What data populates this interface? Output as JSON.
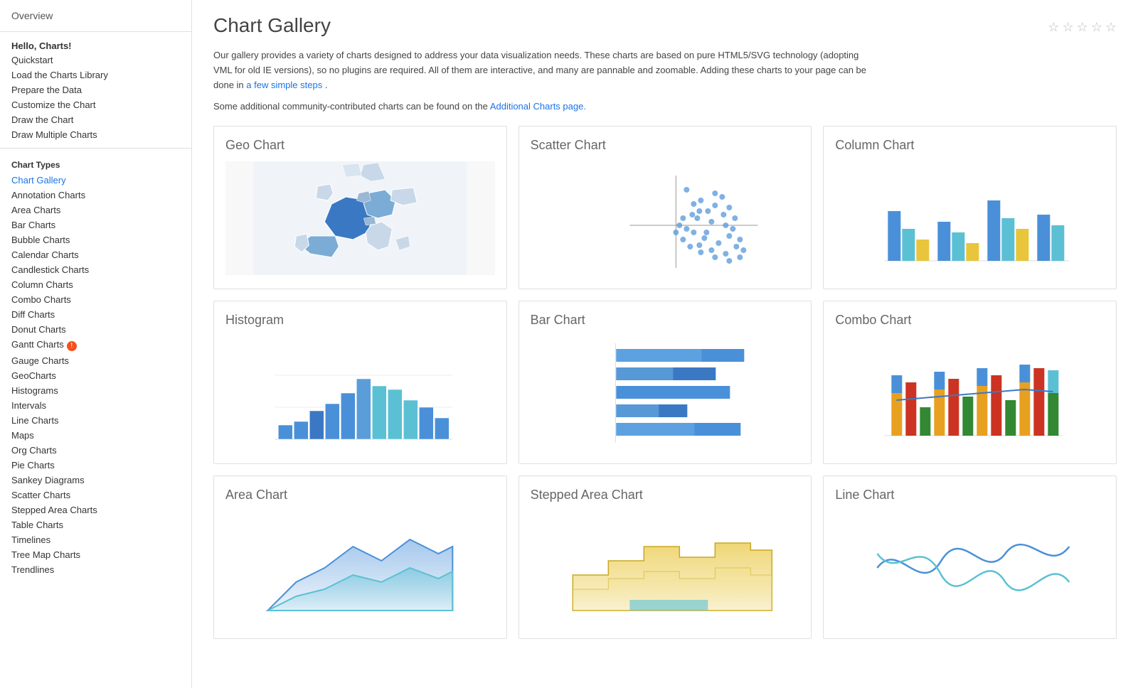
{
  "sidebar": {
    "overview_label": "Overview",
    "hello_label": "Hello, Charts!",
    "links": [
      {
        "label": "Quickstart",
        "active": false
      },
      {
        "label": "Load the Charts Library",
        "active": false
      },
      {
        "label": "Prepare the Data",
        "active": false
      },
      {
        "label": "Customize the Chart",
        "active": false
      },
      {
        "label": "Draw the Chart",
        "active": false
      },
      {
        "label": "Draw Multiple Charts",
        "active": false
      }
    ],
    "chart_types_title": "Chart Types",
    "chart_types": [
      {
        "label": "Chart Gallery",
        "active": true
      },
      {
        "label": "Annotation Charts",
        "active": false
      },
      {
        "label": "Area Charts",
        "active": false
      },
      {
        "label": "Bar Charts",
        "active": false
      },
      {
        "label": "Bubble Charts",
        "active": false
      },
      {
        "label": "Calendar Charts",
        "active": false
      },
      {
        "label": "Candlestick Charts",
        "active": false
      },
      {
        "label": "Column Charts",
        "active": false
      },
      {
        "label": "Combo Charts",
        "active": false
      },
      {
        "label": "Diff Charts",
        "active": false
      },
      {
        "label": "Donut Charts",
        "active": false
      },
      {
        "label": "Gantt Charts",
        "active": false,
        "badge": true
      },
      {
        "label": "Gauge Charts",
        "active": false
      },
      {
        "label": "GeoCharts",
        "active": false
      },
      {
        "label": "Histograms",
        "active": false
      },
      {
        "label": "Intervals",
        "active": false
      },
      {
        "label": "Line Charts",
        "active": false
      },
      {
        "label": "Maps",
        "active": false
      },
      {
        "label": "Org Charts",
        "active": false
      },
      {
        "label": "Pie Charts",
        "active": false
      },
      {
        "label": "Sankey Diagrams",
        "active": false
      },
      {
        "label": "Scatter Charts",
        "active": false
      },
      {
        "label": "Stepped Area Charts",
        "active": false
      },
      {
        "label": "Table Charts",
        "active": false
      },
      {
        "label": "Timelines",
        "active": false
      },
      {
        "label": "Tree Map Charts",
        "active": false
      },
      {
        "label": "Trendlines",
        "active": false
      }
    ]
  },
  "main": {
    "title": "Chart Gallery",
    "stars": [
      "☆",
      "☆",
      "☆",
      "☆",
      "☆"
    ],
    "description1": "Our gallery provides a variety of charts designed to address your data visualization needs. These charts are based on pure HTML5/SVG technology (adopting VML for old IE versions), so no plugins are required. All of them are interactive, and many are pannable and zoomable. Adding these charts to your page can be done in",
    "description_link1": "a few simple steps",
    "description1_end": ".",
    "description2": "Some additional community-contributed charts can be found on the",
    "description_link2": "Additional Charts page.",
    "charts": [
      {
        "title": "Geo Chart",
        "type": "geo"
      },
      {
        "title": "Scatter Chart",
        "type": "scatter"
      },
      {
        "title": "Column Chart",
        "type": "column"
      },
      {
        "title": "Histogram",
        "type": "histogram"
      },
      {
        "title": "Bar Chart",
        "type": "bar"
      },
      {
        "title": "Combo Chart",
        "type": "combo"
      },
      {
        "title": "Area Chart",
        "type": "area"
      },
      {
        "title": "Stepped Area Chart",
        "type": "stepped-area"
      },
      {
        "title": "Line Chart",
        "type": "line"
      }
    ]
  }
}
